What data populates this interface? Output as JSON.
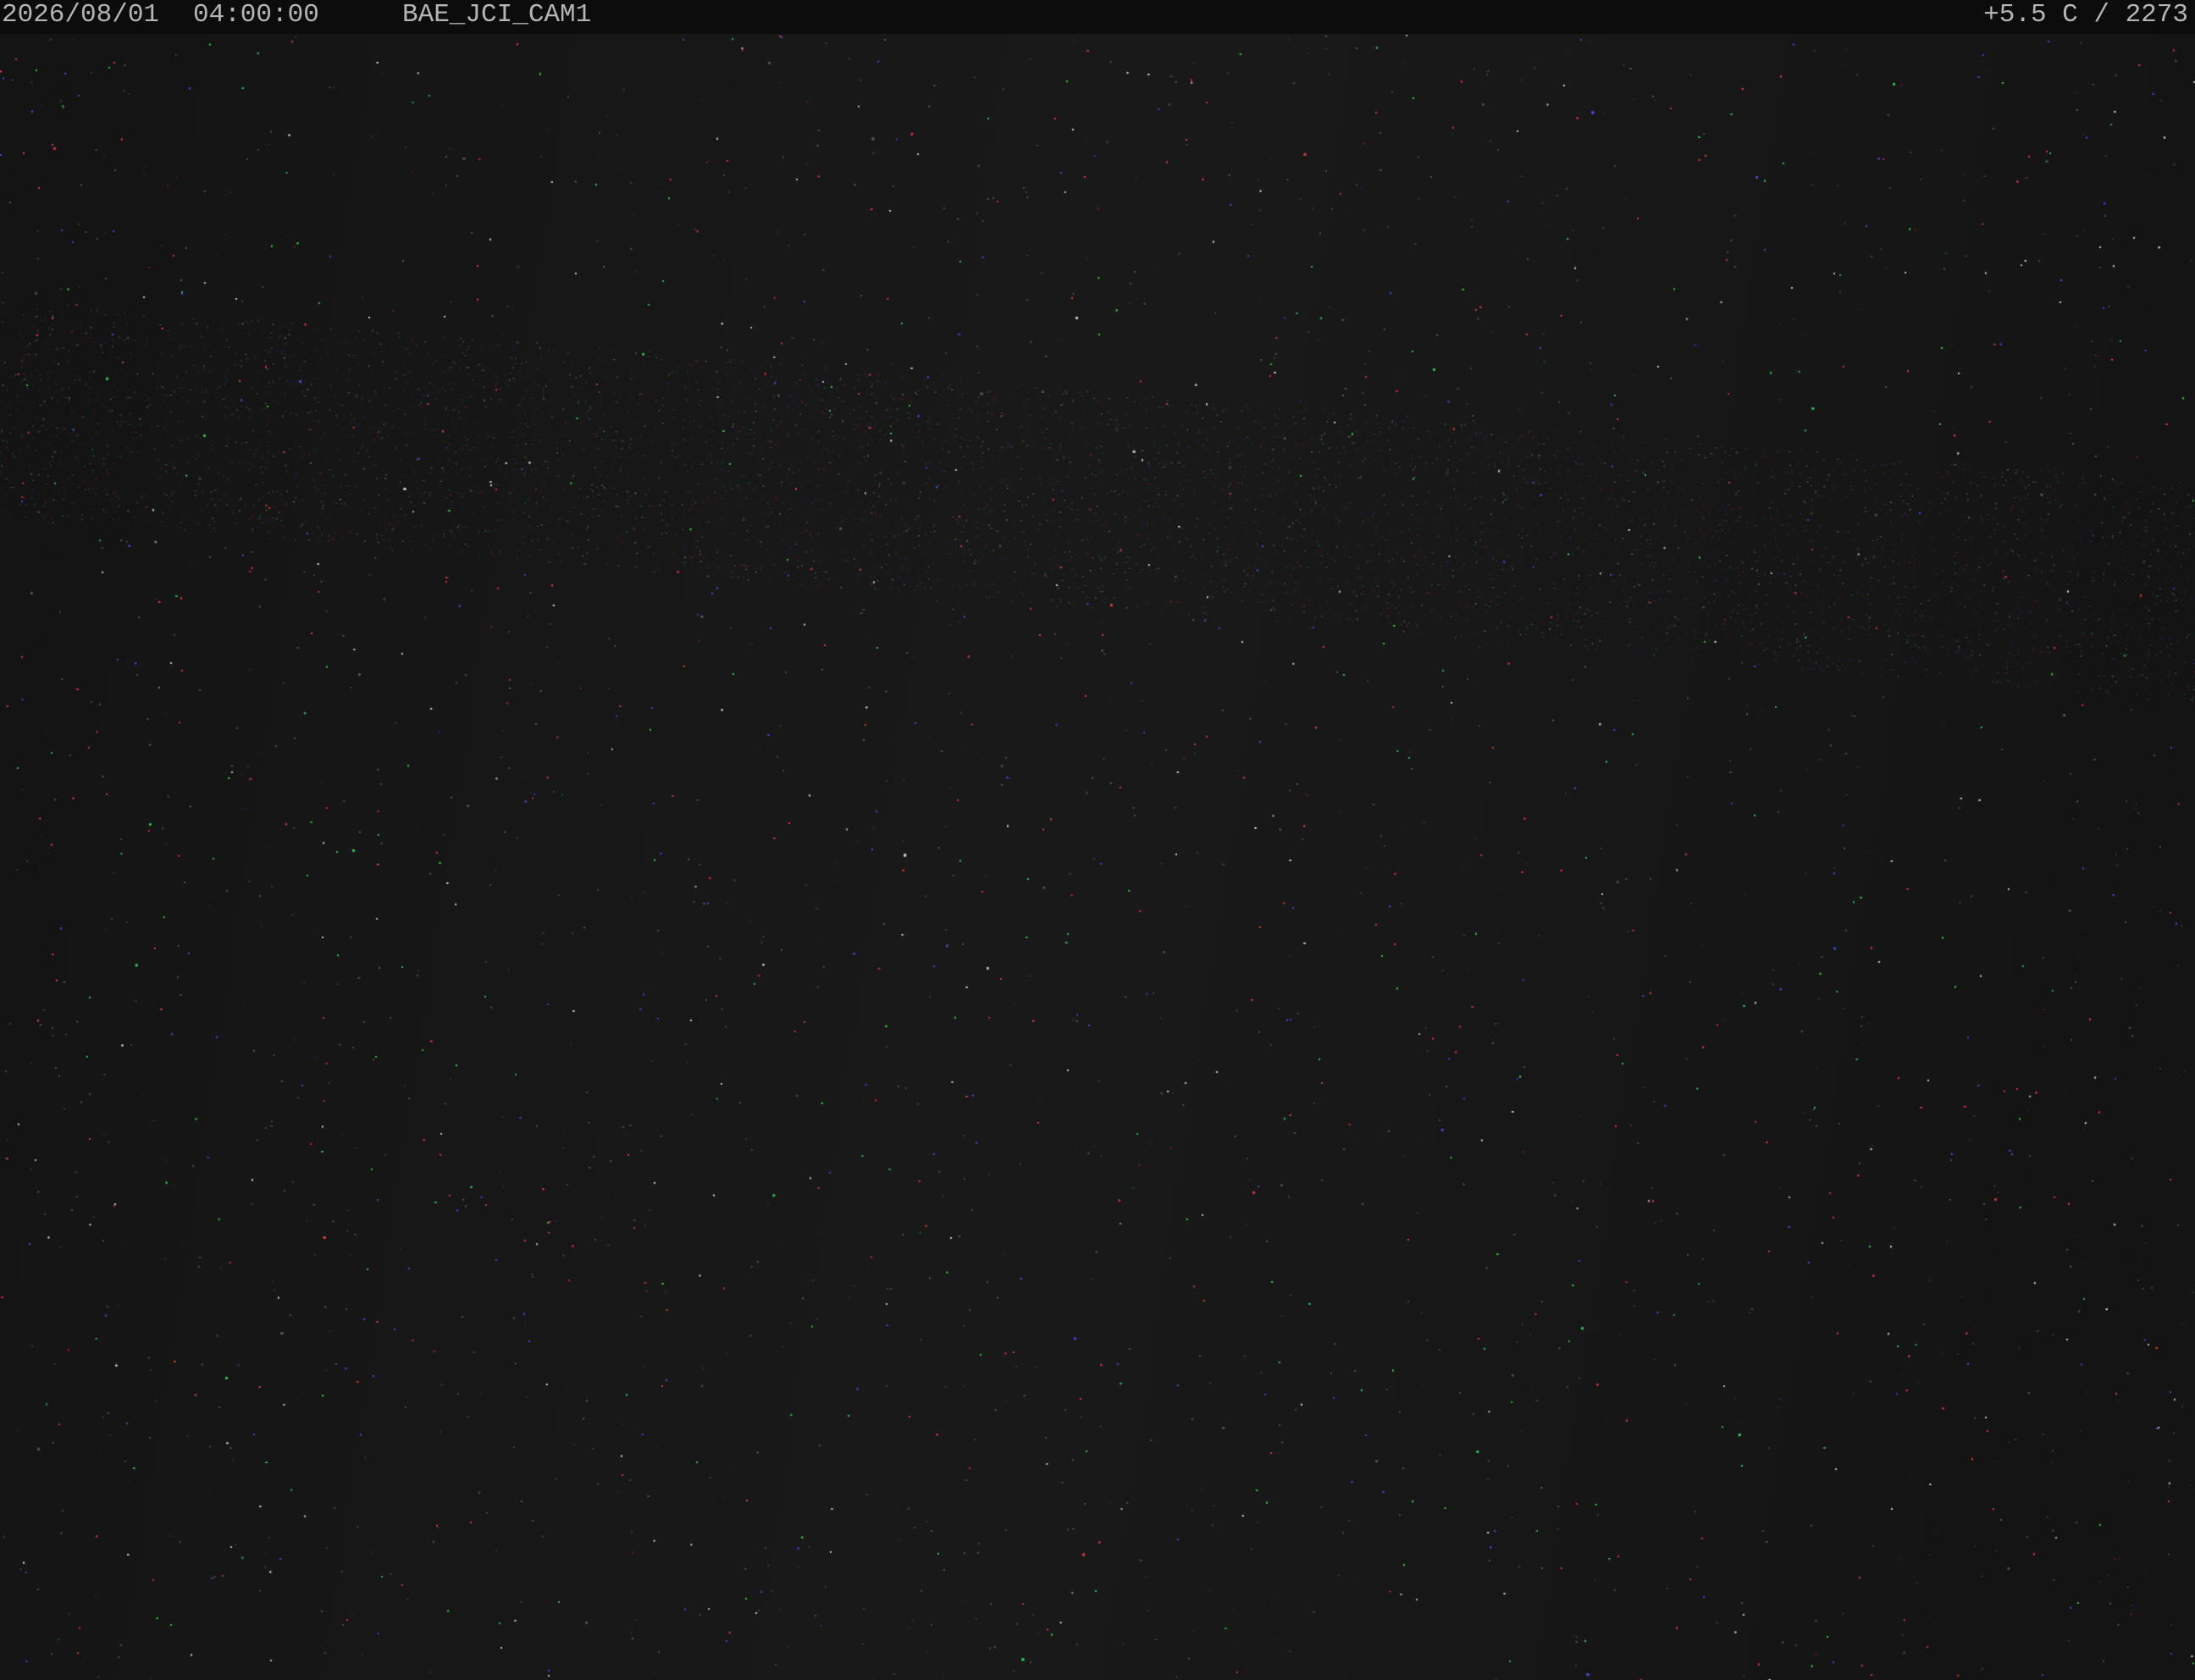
{
  "overlay": {
    "date": "2026/08/01",
    "time": "04:00:00",
    "camera_name": "BAE_JCI_CAM1",
    "temperature_reading": "+5.5 C / 2273"
  },
  "scene": {
    "description_type": "night-sky",
    "background_color": "#141414",
    "star_colors": [
      "#d23c4a",
      "#4a4ad2",
      "#3cbe5a",
      "#c8c8c8"
    ]
  }
}
